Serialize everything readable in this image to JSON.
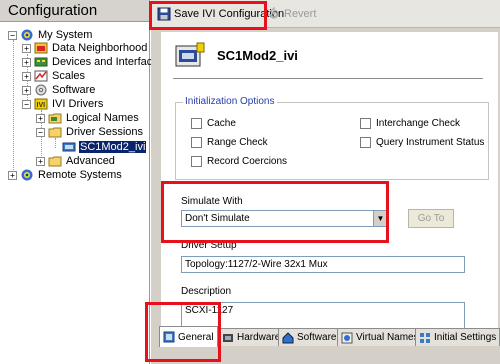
{
  "left_panel": {
    "title": "Configuration",
    "tree": [
      {
        "label": "My System"
      },
      {
        "label": "Data Neighborhood"
      },
      {
        "label": "Devices and Interfaces"
      },
      {
        "label": "Scales"
      },
      {
        "label": "Software"
      },
      {
        "label": "IVI Drivers"
      },
      {
        "label": "Logical Names"
      },
      {
        "label": "Driver Sessions"
      },
      {
        "label": "SC1Mod2_ivi"
      },
      {
        "label": "Advanced"
      },
      {
        "label": "Remote Systems"
      }
    ]
  },
  "toolbar": {
    "save_label": "Save IVI Configuration",
    "revert_label": "Revert"
  },
  "session": {
    "title": "SC1Mod2_ivi"
  },
  "init_options": {
    "legend": "Initialization Options",
    "cache": "Cache",
    "range_check": "Range Check",
    "record_coercions": "Record Coercions",
    "interchange_check": "Interchange Check",
    "query_status": "Query Instrument Status"
  },
  "simulate": {
    "label": "Simulate With",
    "value": "Don't Simulate",
    "goto_label": "Go To"
  },
  "driver_setup": {
    "label": "Driver Setup",
    "value": "Topology:1127/2-Wire 32x1 Mux"
  },
  "description": {
    "label": "Description",
    "value": "SCXI-1127"
  },
  "tabs": {
    "general": "General",
    "hardware": "Hardware",
    "software": "Software",
    "virtual_names": "Virtual Names",
    "initial_settings": "Initial Settings"
  },
  "colors": {
    "highlight_red": "#e8101a",
    "selection_blue": "#0a246a",
    "legend_blue": "#2a3ea8"
  }
}
